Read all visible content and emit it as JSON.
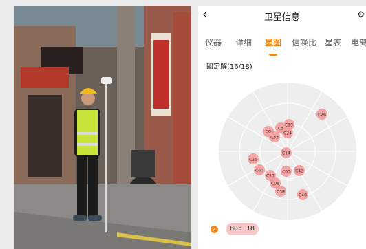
{
  "header": {
    "back_icon": "‹",
    "title": "卫星信息",
    "right_icon": "settings-icon"
  },
  "tabs": [
    {
      "label": "仪器"
    },
    {
      "label": "详细"
    },
    {
      "label": "星图",
      "active": true
    },
    {
      "label": "信噪比"
    },
    {
      "label": "星表"
    },
    {
      "label": "电离"
    }
  ],
  "status": {
    "fix_text": "固定解(16/18)"
  },
  "legend": {
    "bd_label": "BD: 18",
    "bd_color": "#f8c9c9",
    "check_color": "#f08a1e"
  },
  "skyplot": {
    "satellites": [
      {
        "id": "C26"
      },
      {
        "id": "C39"
      },
      {
        "id": "C0"
      },
      {
        "id": "C3"
      },
      {
        "id": "C24"
      },
      {
        "id": "C33"
      },
      {
        "id": "C14"
      },
      {
        "id": "C25"
      },
      {
        "id": "C60"
      },
      {
        "id": "C13"
      },
      {
        "id": "C08"
      },
      {
        "id": "C03"
      },
      {
        "id": "C42"
      },
      {
        "id": "C38"
      },
      {
        "id": "C40"
      }
    ]
  },
  "colors": {
    "accent": "#f08a1e",
    "satellite_fill": "#f4a3a3",
    "sky_bg": "#eeeeee"
  }
}
